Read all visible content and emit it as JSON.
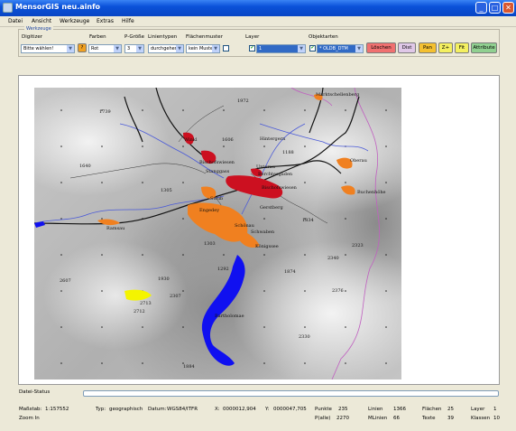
{
  "window": {
    "title": "MensorGIS neu.ainfo",
    "minimize": "_",
    "maximize": "□",
    "close": "✕"
  },
  "menu": [
    "Datei",
    "Ansicht",
    "Werkzeuge",
    "Extras",
    "Hilfe"
  ],
  "toolbar": {
    "group_label": "Werkzeuge",
    "digitizer": {
      "label": "Digitizer",
      "value": "Bitte wählen!"
    },
    "help_btn": "?",
    "farben": {
      "label": "Farben",
      "value": "Rot"
    },
    "pgroesse": {
      "label": "P-Größe",
      "value": "3"
    },
    "linientypen": {
      "label": "Linientypen",
      "value": "durchgehend"
    },
    "flaechenmuster": {
      "label": "Flächenmuster",
      "value": "kein Muster"
    },
    "layer": {
      "label": "Layer",
      "value": "1"
    },
    "objektarten": {
      "label": "Objektarten",
      "value": "* OLDB_DTM"
    },
    "buttons": {
      "loeschen": "Löschen",
      "dist": "Dist",
      "pan": "Pan",
      "zplus": "Z+",
      "fit": "Fit",
      "attribute": "Attribute"
    }
  },
  "map": {
    "places": [
      "Marktschellenberg",
      "Winkl",
      "Bischofswiesen",
      "Stanggass",
      "Berchtesgaden",
      "Unterau",
      "Bischofswiesen",
      "Strub",
      "Engedey",
      "Gerstberg",
      "Schönau",
      "Schwaben",
      "Königssee",
      "Ramsau",
      "Bartholomae",
      "Hintergern",
      "Oberau",
      "Buchenhöhe"
    ],
    "elevations": [
      "1972",
      "1739",
      "1606",
      "1188",
      "1640",
      "1305",
      "1834",
      "1303",
      "2323",
      "2340",
      "1292",
      "1874",
      "2376",
      "2607",
      "1930",
      "2307",
      "2713",
      "2712",
      "2330",
      "1884"
    ]
  },
  "status": {
    "label": "Datei-Status",
    "progress": 0,
    "massstab_label": "Maßstab:",
    "massstab": "1:157552",
    "zoom": "Zoom In",
    "typ_label": "Typ:",
    "typ": "geographisch",
    "datum_label": "Datum:",
    "datum": "WGS84/ITFR",
    "x_label": "X:",
    "x": "0000012,904",
    "y_label": "Y:",
    "y": "0000047,705",
    "punkte_label": "Punkte",
    "punkte": "235",
    "pfaelle_label": "P(alle)",
    "pfaelle": "2270",
    "linien_label": "Linien",
    "linien": "1366",
    "mlinien_label": "MLinien",
    "mlinien": "66",
    "flaechen_label": "Flächen",
    "flaechen": "25",
    "texte_label": "Texte",
    "texte": "39",
    "layer_label": "Layer",
    "layer": "1",
    "klassen_label": "Klassen",
    "klassen": "10"
  },
  "colors": {
    "titlebar": "#0a51d9",
    "river": "#4a5ad8",
    "lake": "#1010f0",
    "urban_red": "#cc1020",
    "urban_orange": "#f08020",
    "yellow": "#f4f400",
    "border": "#c060c0"
  }
}
